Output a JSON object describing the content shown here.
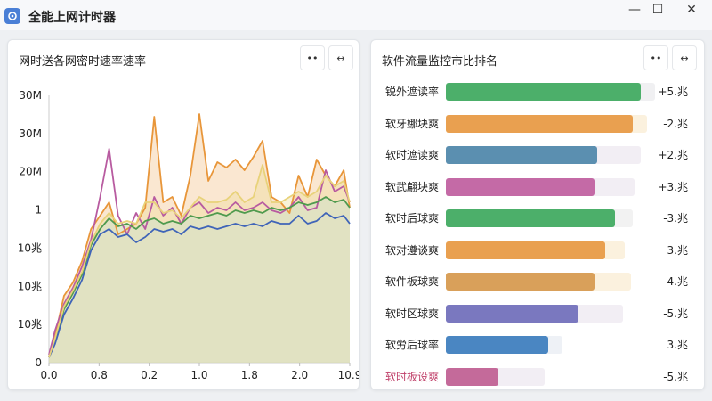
{
  "window": {
    "title": "全能上网计时器",
    "minimize": "—",
    "maximize": "☐",
    "close": "✕",
    "icon": "network-app-icon"
  },
  "left_panel": {
    "title": "网时送各网密时速率速率",
    "btn_collapse": "••",
    "btn_expand": "↔"
  },
  "right_panel": {
    "title": "软件流量监控市比排名",
    "btn_collapse": "••",
    "btn_expand": "↔",
    "rows": [
      {
        "label": "锐外遮读率",
        "value": "+5.兆",
        "fill": 0.97,
        "track": 1.04,
        "color": "#4caf6a",
        "track_color": "#f0f0f2"
      },
      {
        "label": "软牙娜块爽",
        "value": "-2.兆",
        "fill": 0.93,
        "track": 1.0,
        "color": "#e9a050",
        "track_color": "#fbf1de"
      },
      {
        "label": "软时遮读爽",
        "value": "+2.兆",
        "fill": 0.75,
        "track": 0.97,
        "color": "#5b8fb0",
        "track_color": "#f2eef4"
      },
      {
        "label": "软武翩块爽",
        "value": "+3.兆",
        "fill": 0.74,
        "track": 0.94,
        "color": "#c46aa6",
        "track_color": "#f2eef4"
      },
      {
        "label": "软时后球爽",
        "value": "-3.兆",
        "fill": 0.84,
        "track": 0.93,
        "color": "#4caf6a",
        "track_color": "#f2f2f2"
      },
      {
        "label": "软对遵谈爽",
        "value": "3.兆",
        "fill": 0.79,
        "track": 0.89,
        "color": "#e9a050",
        "track_color": "#fbf1de"
      },
      {
        "label": "软件板球爽",
        "value": "-4.兆",
        "fill": 0.74,
        "track": 0.92,
        "color": "#d9a05a",
        "track_color": "#fbf1de"
      },
      {
        "label": "软时区球爽",
        "value": "-5.兆",
        "fill": 0.66,
        "track": 0.88,
        "color": "#7a78bf",
        "track_color": "#f2eef4"
      },
      {
        "label": "软労后球率",
        "value": "3.兆",
        "fill": 0.51,
        "track": 0.58,
        "color": "#4a86c2",
        "track_color": "#eef1f6"
      },
      {
        "label": "软时板设爽",
        "value": "-5.兆",
        "fill": 0.26,
        "track": 0.49,
        "color": "#c46a9a",
        "track_color": "#f2eef4",
        "label_color": "#c0406a"
      }
    ]
  },
  "chart_data": {
    "type": "line",
    "title": "网时送各网密时速率速率",
    "y_tick_labels": [
      "30M",
      "30M",
      "20M",
      "1",
      "10兆",
      "10兆",
      "10兆",
      "0"
    ],
    "x_tick_labels": [
      "0.0",
      "0.8",
      "0.2",
      "1.0",
      "1.8",
      "2.0",
      "10.9"
    ],
    "x": [
      0,
      0.02,
      0.05,
      0.08,
      0.11,
      0.14,
      0.17,
      0.2,
      0.23,
      0.26,
      0.29,
      0.32,
      0.35,
      0.38,
      0.41,
      0.44,
      0.47,
      0.5,
      0.53,
      0.56,
      0.59,
      0.62,
      0.65,
      0.68,
      0.71,
      0.74,
      0.77,
      0.8,
      0.83,
      0.86,
      0.89,
      0.92,
      0.95,
      0.98,
      1.0
    ],
    "series": [
      {
        "color": "#e8963a",
        "values": [
          0.02,
          0.1,
          0.25,
          0.3,
          0.38,
          0.5,
          0.55,
          0.6,
          0.48,
          0.5,
          0.52,
          0.58,
          0.92,
          0.6,
          0.62,
          0.55,
          0.7,
          0.93,
          0.68,
          0.75,
          0.73,
          0.76,
          0.72,
          0.77,
          0.83,
          0.62,
          0.6,
          0.56,
          0.7,
          0.62,
          0.76,
          0.7,
          0.66,
          0.72,
          0.58
        ]
      },
      {
        "color": "#b85ba0",
        "values": [
          0.03,
          0.12,
          0.22,
          0.28,
          0.36,
          0.46,
          0.62,
          0.8,
          0.55,
          0.48,
          0.56,
          0.5,
          0.62,
          0.55,
          0.58,
          0.52,
          0.58,
          0.6,
          0.56,
          0.58,
          0.57,
          0.6,
          0.57,
          0.58,
          0.6,
          0.57,
          0.56,
          0.58,
          0.62,
          0.57,
          0.58,
          0.72,
          0.64,
          0.66,
          0.6
        ]
      },
      {
        "color": "#4f9a4e",
        "values": [
          0.02,
          0.08,
          0.2,
          0.26,
          0.33,
          0.44,
          0.5,
          0.54,
          0.51,
          0.52,
          0.5,
          0.53,
          0.54,
          0.52,
          0.53,
          0.52,
          0.55,
          0.54,
          0.55,
          0.56,
          0.55,
          0.57,
          0.56,
          0.57,
          0.56,
          0.58,
          0.57,
          0.58,
          0.6,
          0.59,
          0.6,
          0.62,
          0.6,
          0.61,
          0.58
        ]
      },
      {
        "color": "#3f64b8",
        "values": [
          0.02,
          0.07,
          0.18,
          0.24,
          0.31,
          0.42,
          0.48,
          0.5,
          0.47,
          0.48,
          0.45,
          0.47,
          0.5,
          0.49,
          0.5,
          0.48,
          0.51,
          0.5,
          0.51,
          0.5,
          0.51,
          0.52,
          0.51,
          0.52,
          0.51,
          0.53,
          0.52,
          0.52,
          0.55,
          0.52,
          0.53,
          0.56,
          0.54,
          0.55,
          0.52
        ]
      },
      {
        "color": "#e8d27a",
        "values": [
          0.02,
          0.09,
          0.21,
          0.27,
          0.34,
          0.45,
          0.52,
          0.56,
          0.52,
          0.53,
          0.52,
          0.6,
          0.6,
          0.56,
          0.57,
          0.54,
          0.58,
          0.62,
          0.6,
          0.6,
          0.61,
          0.64,
          0.6,
          0.62,
          0.74,
          0.6,
          0.6,
          0.62,
          0.64,
          0.62,
          0.64,
          0.7,
          0.66,
          0.68,
          0.6
        ]
      }
    ]
  }
}
